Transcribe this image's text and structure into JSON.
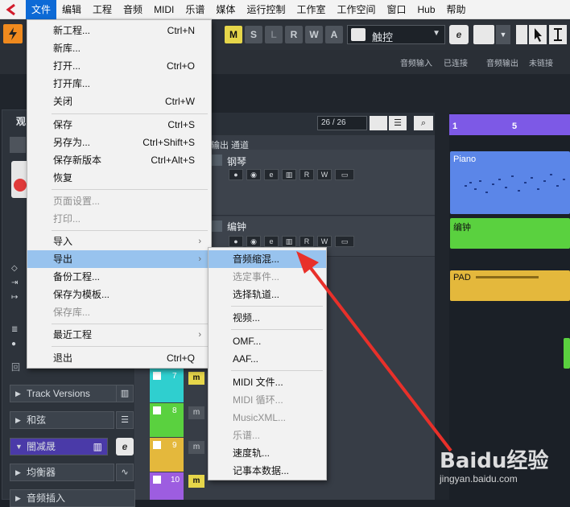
{
  "menubar": {
    "items": [
      "文件",
      "编辑",
      "工程",
      "音频",
      "MIDI",
      "乐谱",
      "媒体",
      "运行控制",
      "工作室",
      "工作空间",
      "窗口",
      "Hub",
      "帮助"
    ],
    "active_index": 0
  },
  "toolbar": {
    "automation_buttons": [
      "M",
      "S",
      "L",
      "R",
      "W",
      "A"
    ],
    "touch_mode": "触控",
    "audio_in_label": "音频输入",
    "connected_label": "已连接",
    "audio_out_label": "音频输出",
    "not_linked_label": "未链接"
  },
  "file_menu": {
    "items": [
      {
        "label": "新工程...",
        "shortcut": "Ctrl+N"
      },
      {
        "label": "新库...",
        "shortcut": ""
      },
      {
        "label": "打开...",
        "shortcut": "Ctrl+O"
      },
      {
        "label": "打开库...",
        "shortcut": ""
      },
      {
        "label": "关闭",
        "shortcut": "Ctrl+W"
      },
      {
        "label": "保存",
        "shortcut": "Ctrl+S"
      },
      {
        "label": "另存为...",
        "shortcut": "Ctrl+Shift+S"
      },
      {
        "label": "保存新版本",
        "shortcut": "Ctrl+Alt+S"
      },
      {
        "label": "恢复",
        "shortcut": ""
      },
      {
        "label": "页面设置...",
        "shortcut": ""
      },
      {
        "label": "打印...",
        "shortcut": ""
      },
      {
        "label": "导入",
        "shortcut": ""
      },
      {
        "label": "导出",
        "shortcut": ""
      },
      {
        "label": "备份工程...",
        "shortcut": ""
      },
      {
        "label": "保存为模板...",
        "shortcut": ""
      },
      {
        "label": "保存库...",
        "shortcut": ""
      },
      {
        "label": "最近工程",
        "shortcut": ""
      },
      {
        "label": "退出",
        "shortcut": "Ctrl+Q"
      }
    ]
  },
  "export_submenu": {
    "items": [
      "音频缩混...",
      "选定事件...",
      "选择轨道...",
      "视频...",
      "OMF...",
      "AAF...",
      "MIDI 文件...",
      "MIDI 循环...",
      "MusicXML...",
      "乐谱...",
      "速度轨...",
      "记事本数据..."
    ]
  },
  "tracks": {
    "counter": "26 / 26",
    "header_label": "输出 通道",
    "track_names": [
      "钢琴",
      "编钟"
    ],
    "track_numbers": [
      "7",
      "8",
      "9",
      "10"
    ],
    "colors": [
      "#2fcfcf",
      "#5ad13f",
      "#e4b83c",
      "#9d5de0"
    ]
  },
  "inspector": {
    "panel_title": "观",
    "sections": [
      "Track Versions",
      "和弦",
      "闇减晟",
      "均衡器",
      "音频插入"
    ],
    "partial_label": "回"
  },
  "arrange": {
    "ruler_marks": [
      "1",
      "5"
    ],
    "parts": [
      "Piano",
      "编钟",
      "PAD"
    ],
    "colors": {
      "piano": "#5b86e8",
      "bianzhong": "#5ad13f",
      "pad": "#e4b83c",
      "ruler": "#7d59e6"
    }
  },
  "watermark": {
    "brand": "Baidu经验",
    "url": "jingyan.baidu.com"
  }
}
